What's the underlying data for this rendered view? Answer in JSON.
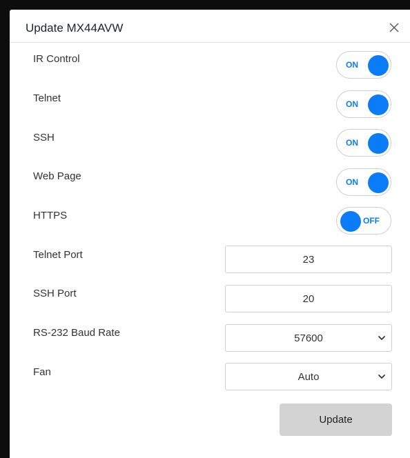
{
  "modal": {
    "title": "Update MX44AVW",
    "close_icon": "close-icon"
  },
  "toggles": [
    {
      "label": "IR Control",
      "state": "ON"
    },
    {
      "label": "Telnet",
      "state": "ON"
    },
    {
      "label": "SSH",
      "state": "ON"
    },
    {
      "label": "Web Page",
      "state": "ON"
    },
    {
      "label": "HTTPS",
      "state": "OFF"
    }
  ],
  "fields": {
    "telnet_port": {
      "label": "Telnet Port",
      "value": "23"
    },
    "ssh_port": {
      "label": "SSH Port",
      "value": "20"
    },
    "baud_rate": {
      "label": "RS-232 Baud Rate",
      "value": "57600"
    },
    "fan": {
      "label": "Fan",
      "value": "Auto"
    }
  },
  "actions": {
    "update_label": "Update"
  },
  "colors": {
    "toggle_accent": "#0a7cf7",
    "button_bg": "#d3d3d3"
  }
}
